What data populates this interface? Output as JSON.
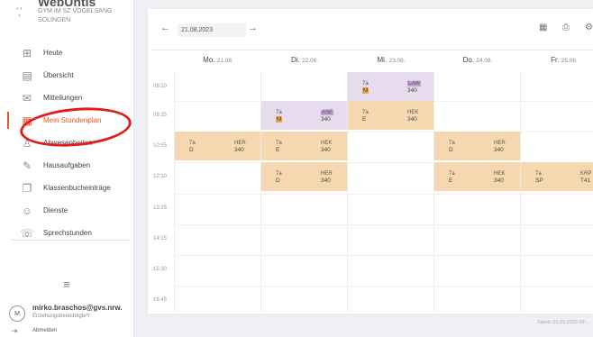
{
  "brand": {
    "logo": "ʼ,ʼ",
    "title": "WebUntis",
    "line1": "GYM IM SZ VOGELSANG",
    "line2": "SOLINGEN"
  },
  "nav": [
    {
      "label": "Heute",
      "icon": "grid-icon"
    },
    {
      "label": "Übersicht",
      "icon": "overview-icon"
    },
    {
      "label": "Mitteilungen",
      "icon": "mail-icon"
    },
    {
      "label": "Mein Stundenplan",
      "icon": "calendar-icon",
      "active": true
    },
    {
      "label": "Abwesenheiten",
      "icon": "absence-icon"
    },
    {
      "label": "Hausaufgaben",
      "icon": "homework-icon"
    },
    {
      "label": "Klassenbucheinträge",
      "icon": "classbook-icon"
    },
    {
      "label": "Dienste",
      "icon": "duties-icon"
    },
    {
      "label": "Sprechstunden",
      "icon": "consultation-icon"
    }
  ],
  "menu_icon": "≡",
  "user": {
    "initial": "M",
    "name": "mirko.braschos@gvs.nrw.",
    "role": "Erziehungsberechtigte*r",
    "logout": "Abmelden"
  },
  "toolbar": {
    "date": "21.08.2023",
    "prev": "←",
    "next": "→",
    "calendar": "▦",
    "print": "⎙",
    "settings": "⚙"
  },
  "days": [
    {
      "name": "Mo.",
      "date": "21.08."
    },
    {
      "name": "Di.",
      "date": "22.08."
    },
    {
      "name": "Mi.",
      "date": "23.08."
    },
    {
      "name": "Do.",
      "date": "24.08."
    },
    {
      "name": "Fr.",
      "date": "25.08."
    }
  ],
  "times": [
    "08:10",
    "09:25",
    "10:55",
    "12:10",
    "13:25",
    "14:15",
    "15:30",
    "16:45"
  ],
  "lessons": [
    {
      "day": 2,
      "slot": 0,
      "color": "purple",
      "t": "7a",
      "s": "M",
      "r1": "LAW",
      "r2": "340",
      "s_tag": "orange",
      "r1_tag": "violet"
    },
    {
      "day": 1,
      "slot": 1,
      "color": "purple",
      "t": "7a",
      "s": "M",
      "r1": "ASE",
      "r2": "340",
      "s_tag": "orange",
      "r1_tag": "violet"
    },
    {
      "day": 2,
      "slot": 1,
      "color": "orange",
      "t": "7a",
      "s": "E",
      "r1": "HEK",
      "r2": "340"
    },
    {
      "day": 0,
      "slot": 2,
      "color": "orange",
      "t": "7a",
      "s": "D",
      "r1": "HER",
      "r2": "340"
    },
    {
      "day": 1,
      "slot": 2,
      "color": "orange",
      "t": "7a",
      "s": "E",
      "r1": "HEK",
      "r2": "340"
    },
    {
      "day": 3,
      "slot": 2,
      "color": "orange",
      "t": "7a",
      "s": "D",
      "r1": "HER",
      "r2": "340"
    },
    {
      "day": 1,
      "slot": 3,
      "color": "orange",
      "t": "7a",
      "s": "D",
      "r1": "HER",
      "r2": "340"
    },
    {
      "day": 3,
      "slot": 3,
      "color": "orange",
      "t": "7a",
      "s": "E",
      "r1": "HEK",
      "r2": "340"
    },
    {
      "day": 4,
      "slot": 3,
      "color": "orange",
      "t": "7a",
      "s": "SP",
      "r1": "KRP",
      "r2": "T41"
    }
  ],
  "stamp": "Stand: 02.09.2023 09:..."
}
